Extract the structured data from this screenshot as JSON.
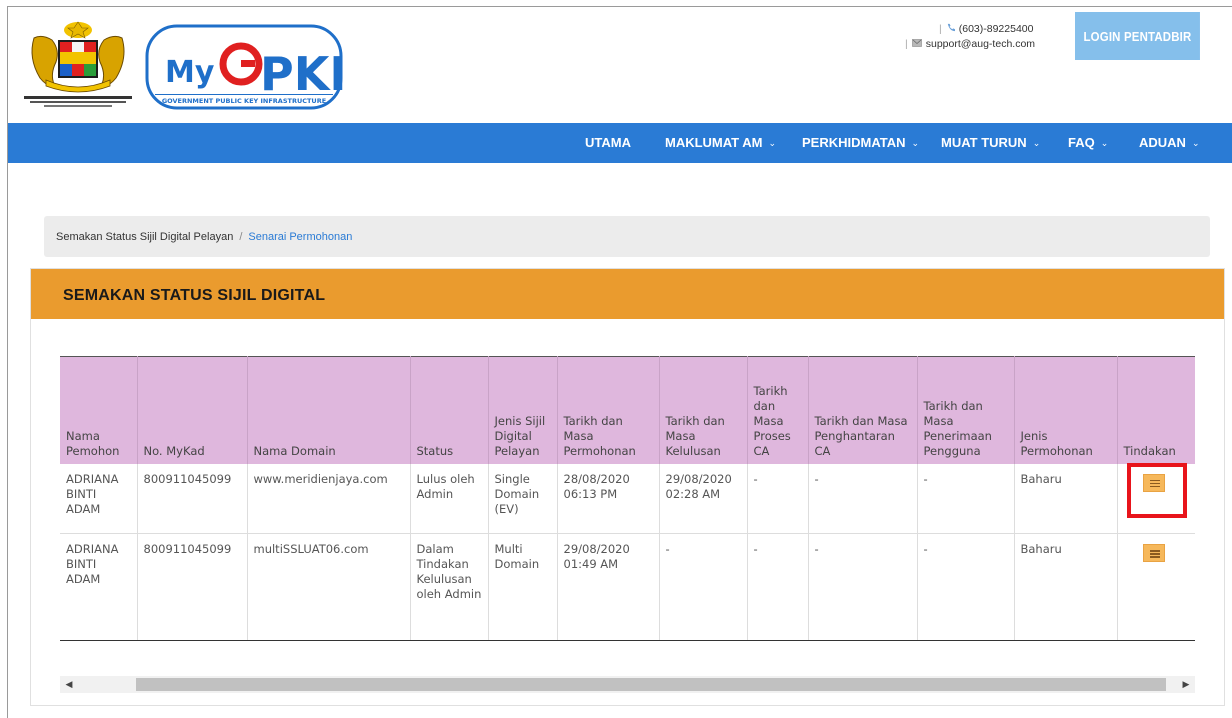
{
  "header": {
    "contact_phone": "(603)-89225400",
    "contact_email": "support@aug-tech.com",
    "login_label": "LOGIN PENTADBIR",
    "logo_text": "MyGPKI",
    "logo_subtitle": "GOVERNMENT PUBLIC KEY INFRASTRUCTURE"
  },
  "nav": {
    "items": [
      {
        "label": "UTAMA",
        "dropdown": false
      },
      {
        "label": "MAKLUMAT AM",
        "dropdown": true
      },
      {
        "label": "PERKHIDMATAN",
        "dropdown": true
      },
      {
        "label": "MUAT TURUN",
        "dropdown": true
      },
      {
        "label": "FAQ",
        "dropdown": true
      },
      {
        "label": "ADUAN",
        "dropdown": true
      }
    ],
    "chevron": "⌄"
  },
  "breadcrumb": {
    "parent": "Semakan Status Sijil Digital Pelayan",
    "separator": "/",
    "current": "Senarai Permohonan"
  },
  "panel": {
    "title": "SEMAKAN STATUS SIJIL DIGITAL"
  },
  "table": {
    "headers": [
      "Nama Pemohon",
      "No. MyKad",
      "Nama Domain",
      "Status",
      "Jenis Sijil Digital Pelayan",
      "Tarikh dan Masa Permohonan",
      "Tarikh dan Masa Kelulusan",
      "Tarikh dan Masa Proses CA",
      "Tarikh dan Masa Penghantaran CA",
      "Tarikh dan Masa Penerimaan Pengguna",
      "Jenis Permohonan",
      "Tindakan"
    ],
    "rows": [
      {
        "nama": "ADRIANA BINTI ADAM",
        "mykad": "800911045099",
        "domain": "www.meridienjaya.com",
        "status": "Lulus oleh Admin",
        "jenis_sijil": "Single Domain (EV)",
        "tarikh_permohonan": "28/08/2020 06:13 PM",
        "tarikh_kelulusan": "29/08/2020 02:28 AM",
        "tarikh_proses": "-",
        "tarikh_penghantaran": "-",
        "tarikh_penerimaan": "-",
        "jenis_permohonan": "Baharu"
      },
      {
        "nama": "ADRIANA BINTI ADAM",
        "mykad": "800911045099",
        "domain": "multiSSLUAT06.com",
        "status": "Dalam Tindakan Kelulusan oleh Admin",
        "jenis_sijil": "Multi Domain",
        "tarikh_permohonan": "29/08/2020 01:49 AM",
        "tarikh_kelulusan": "-",
        "tarikh_proses": "-",
        "tarikh_penghantaran": "-",
        "tarikh_penerimaan": "-",
        "jenis_permohonan": "Baharu"
      }
    ]
  },
  "icons": {
    "phone": "phone-icon",
    "email": "envelope-icon",
    "action": "list-icon",
    "scroll_left": "◀",
    "scroll_right": "▶"
  },
  "colors": {
    "nav": "#2a7bd5",
    "panel_header": "#ea9b2e",
    "table_header": "#dfb7dd",
    "login_button": "#85bfeb",
    "highlight": "#e8141b",
    "action_icon": "#f6b85b"
  }
}
